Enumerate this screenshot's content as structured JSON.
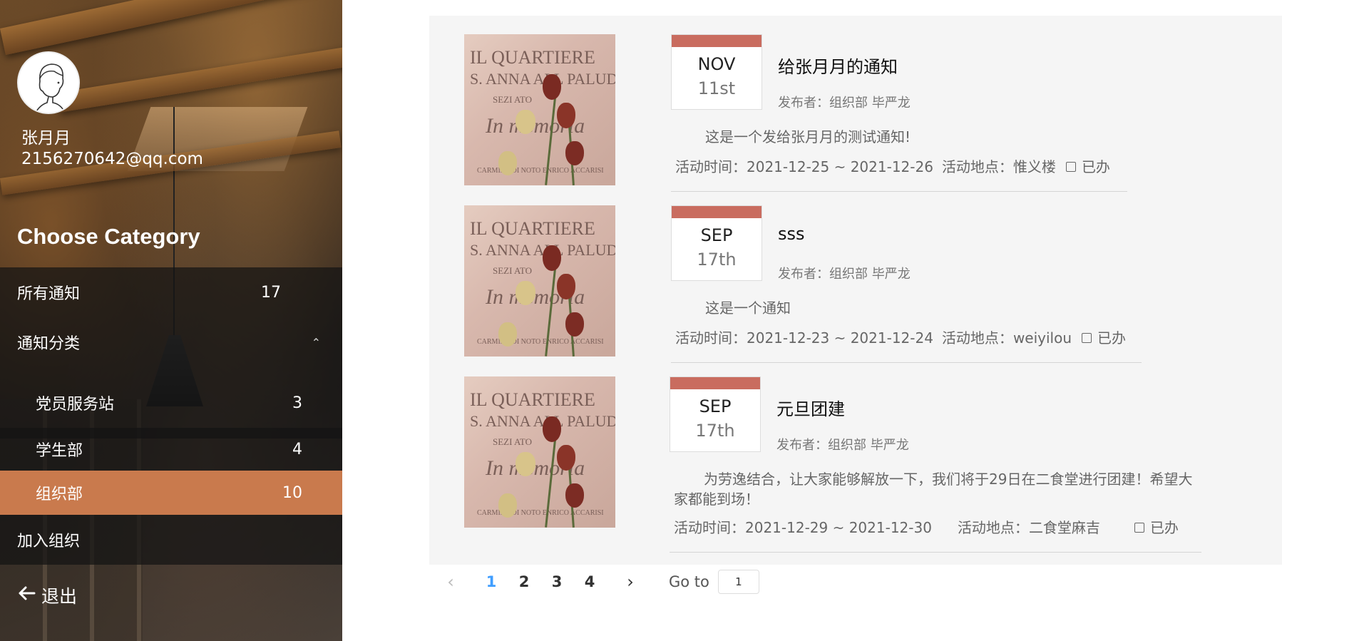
{
  "user": {
    "name": "张月月",
    "email": "2156270642@qq.com"
  },
  "sidebar": {
    "title": "Choose Category",
    "all_notices": {
      "label": "所有通知",
      "count": "17"
    },
    "category_group": {
      "label": "通知分类",
      "expanded": true
    },
    "categories": [
      {
        "label": "党员服务站",
        "count": "3",
        "active": false
      },
      {
        "label": "学生部",
        "count": "4",
        "active": false
      },
      {
        "label": "组织部",
        "count": "10",
        "active": true
      }
    ],
    "join": {
      "label": "加入组织"
    },
    "logout": {
      "label": "退出"
    }
  },
  "notices": [
    {
      "month": "NOV",
      "day": "11st",
      "title": "给张月月的通知",
      "publisher": "发布者：组织部 毕严龙",
      "description": "这是一个发给张月月的测试通知!",
      "time_label": "活动时间：",
      "time": "2021-12-25 ~ 2021-12-26",
      "place_label": "活动地点：",
      "place": "惟义楼",
      "done_label": "已办",
      "done": false
    },
    {
      "month": "SEP",
      "day": "17th",
      "title": "sss",
      "publisher": "发布者：组织部 毕严龙",
      "description": "这是一个通知",
      "time_label": "活动时间：",
      "time": "2021-12-23 ~ 2021-12-24",
      "place_label": "活动地点：",
      "place": "weiyilou",
      "done_label": "已办",
      "done": false
    },
    {
      "month": "SEP",
      "day": "17th",
      "title": "元旦团建",
      "publisher": "发布者：组织部 毕严龙",
      "description": "为劳逸结合，让大家能够解放一下，我们将于29日在二食堂进行团建！希望大家都能到场！",
      "time_label": "活动时间：",
      "time": "2021-12-29 ~ 2021-12-30",
      "place_label": "活动地点：",
      "place": "二食堂麻吉",
      "done_label": "已办",
      "done": false
    }
  ],
  "thumbnail": {
    "sign_lines": [
      "IL QUARTIERE",
      "S. ANNA ALL PALUDI",
      "SEZI  ATO",
      "In memoria",
      "CARMINE DI NOTO ENRICO ACCARISI"
    ]
  },
  "pagination": {
    "pages": [
      "1",
      "2",
      "3",
      "4"
    ],
    "current": "1",
    "goto_label": "Go to",
    "goto_value": "1"
  },
  "colors": {
    "accent_active": "#c97a4d",
    "date_strip": "#c96c5f",
    "page_active": "#409eff"
  },
  "icons": [
    "user-avatar-icon",
    "chevron-up-icon",
    "arrow-left-icon",
    "chevron-left-icon",
    "chevron-right-icon",
    "checkbox-icon"
  ]
}
